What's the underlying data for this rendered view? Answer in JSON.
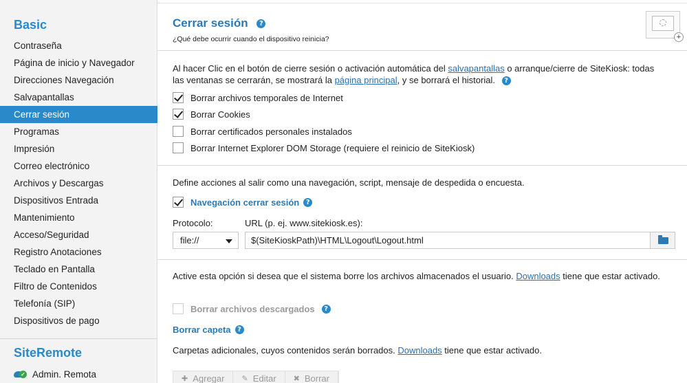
{
  "sidebar": {
    "basic_title": "Basic",
    "items": [
      {
        "label": "Contraseña"
      },
      {
        "label": "Página de inicio y Navegador"
      },
      {
        "label": "Direcciones Navegación"
      },
      {
        "label": "Salvapantallas"
      },
      {
        "label": "Cerrar sesión",
        "active": true
      },
      {
        "label": "Programas"
      },
      {
        "label": "Impresión"
      },
      {
        "label": "Correo electrónico"
      },
      {
        "label": "Archivos y Descargas"
      },
      {
        "label": "Dispositivos Entrada"
      },
      {
        "label": "Mantenimiento"
      },
      {
        "label": "Acceso/Seguridad"
      },
      {
        "label": "Registro Anotaciones"
      },
      {
        "label": "Teclado en Pantalla"
      },
      {
        "label": "Filtro de Contenidos"
      },
      {
        "label": "Telefonía (SIP)"
      },
      {
        "label": "Dispositivos de pago"
      }
    ],
    "siteremote_title": "SiteRemote",
    "siteremote_item": "Admin. Remota",
    "siteremote_icon": "cloud-check-icon"
  },
  "header": {
    "title": "Cerrar sesión",
    "subtitle": "¿Qué debe ocurrir cuando el dispositivo reinicia?",
    "help_glyph": "?"
  },
  "section1": {
    "text_part1": "Al hacer Clic en el botón de cierre sesión o activación automática del ",
    "link_screensaver": "salvapantallas",
    "text_part2": " o arranque/cierre de SiteKiosk: todas las ventanas se cerrarán, se mostrará la ",
    "link_homepage": "página principal",
    "text_part3": ", y se borrará el historial.",
    "options": [
      {
        "label": "Borrar archivos temporales de Internet",
        "checked": true
      },
      {
        "label": "Borrar Cookies",
        "checked": true
      },
      {
        "label": "Borrar certificados personales instalados",
        "checked": false
      },
      {
        "label": "Borrar Internet Explorer DOM Storage (requiere el reinicio de SiteKiosk)",
        "checked": false
      }
    ]
  },
  "section2": {
    "description": "Define acciones al salir como una navegación, script, mensaje de despedida o encuesta.",
    "nav_logout_label": "Navegación cerrar sesión",
    "nav_logout_checked": true,
    "protocol_label": "Protocolo:",
    "protocol_value": "file://",
    "url_label": "URL (p. ej. www.sitekiosk.es):",
    "url_value": "$(SiteKioskPath)\\HTML\\Logout\\Logout.html",
    "browse_icon": "folder-icon"
  },
  "section3": {
    "text_part1": "Active esta opción si desea que el sistema borre los archivos almacenados el usuario. ",
    "link_downloads": "Downloads",
    "text_part2": " tiene que estar activado.",
    "delete_downloads_label": "Borrar archivos descargados",
    "delete_downloads_checked": false,
    "delete_folder_title": "Borrar capeta",
    "folders_text_part1": "Carpetas adicionales, cuyos contenidos serán borrados. ",
    "folders_link": "Downloads",
    "folders_text_part2": " tiene que estar activado.",
    "toolbar": {
      "add": "Agregar",
      "edit": "Editar",
      "delete": "Borrar"
    }
  },
  "colors": {
    "accent": "#2a8ac9",
    "title_blue": "#2a7ab8",
    "link": "#2a6fad",
    "sidebar_bg": "#f3f3f3"
  }
}
